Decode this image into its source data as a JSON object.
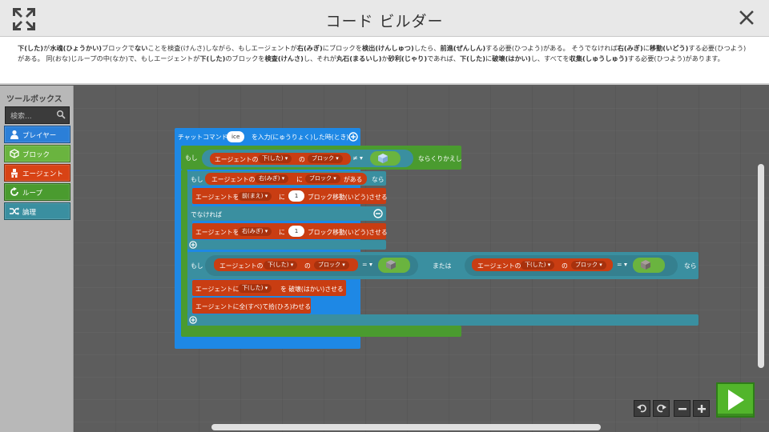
{
  "header": {
    "title": "コード ビルダー"
  },
  "instruction": {
    "segments": [
      {
        "t": "下(した)",
        "b": true
      },
      {
        "t": "が",
        "b": false
      },
      {
        "t": "水魂(ひょうかい)",
        "b": true
      },
      {
        "t": "ブロックで",
        "b": false
      },
      {
        "t": "ない",
        "b": true
      },
      {
        "t": "ことを検査(けんさ)しながら、もしエージェントが",
        "b": false
      },
      {
        "t": "右(みぎ)",
        "b": true
      },
      {
        "t": "にブロックを",
        "b": false
      },
      {
        "t": "検出(けんしゅつ)",
        "b": true
      },
      {
        "t": "したら、",
        "b": false
      },
      {
        "t": "前進(ぜんしん)",
        "b": true
      },
      {
        "t": "する必要(ひつよう)がある。 そうでなければ",
        "b": false
      },
      {
        "t": "右(みぎ)",
        "b": true
      },
      {
        "t": "に",
        "b": false
      },
      {
        "t": "移動(いどう)",
        "b": true
      },
      {
        "t": "する必要(ひつよう)がある。 同(おな)じループの中(なか)で、もしエージェントが",
        "b": false
      },
      {
        "t": "下(した)",
        "b": true
      },
      {
        "t": "のブロックを",
        "b": false
      },
      {
        "t": "検査(けんさ)",
        "b": true
      },
      {
        "t": "し、それが",
        "b": false
      },
      {
        "t": "丸石(まるいし)",
        "b": true
      },
      {
        "t": "か",
        "b": false
      },
      {
        "t": "砂利(じゃり)",
        "b": true
      },
      {
        "t": "であれば、",
        "b": false
      },
      {
        "t": "下(した)",
        "b": true
      },
      {
        "t": "に",
        "b": false
      },
      {
        "t": "破壊(はかい)",
        "b": true
      },
      {
        "t": "し、すべてを",
        "b": false
      },
      {
        "t": "収集(しゅうしゅう)",
        "b": true
      },
      {
        "t": "する必要(ひつよう)があります。",
        "b": false
      }
    ]
  },
  "toolbox": {
    "title": "ツールボックス",
    "search_placeholder": "検索...",
    "items": [
      {
        "label": "プレイヤー",
        "color": "#2b7fd8"
      },
      {
        "label": "ブロック",
        "color": "#6ab43f"
      },
      {
        "label": "エージェント",
        "color": "#d84315"
      },
      {
        "label": "ループ",
        "color": "#4a9b2f"
      },
      {
        "label": "論理",
        "color": "#3a8fa0"
      }
    ]
  },
  "code": {
    "chat_prefix": "チャットコマンド",
    "chat_value": "ice",
    "chat_suffix": "を入力(にゅうりょく)した時(とき)",
    "while": "もし",
    "agent_of": "エージェントの",
    "down": "下(した)",
    "right": "右(みぎ)",
    "forward": "前(まえ)",
    "no": "の",
    "block": "ブロック",
    "ne": "≠",
    "eq": "=",
    "repeat_while": "ならくりかえし",
    "if": "もし",
    "to": "に",
    "exists": "がある",
    "then": "なら",
    "agent_wo": "エージェントを",
    "ni": "に",
    "move_num": "1",
    "move_suffix": "ブロック移動(いどう)させる",
    "else": "でなければ",
    "or": "または",
    "agent_ni": "エージェントに",
    "destroy_suffix": "を 破壊(はかい)させる",
    "collect_all": "エージェントに全(すべ)て拾(ひろ)わせる"
  },
  "colors": {
    "chat": "#1e88e5",
    "loop": "#4a9b2f",
    "logic": "#3a8fa0",
    "agent": "#c93d12",
    "run": "#52b52b"
  }
}
